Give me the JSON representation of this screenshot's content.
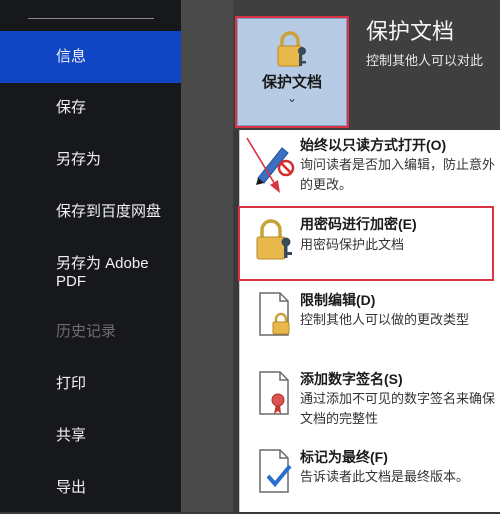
{
  "sidebar": {
    "items": [
      {
        "label": "信息",
        "state": "active"
      },
      {
        "label": "保存",
        "state": "normal"
      },
      {
        "label": "另存为",
        "state": "normal"
      },
      {
        "label": "保存到百度网盘",
        "state": "normal"
      },
      {
        "label": "另存为 Adobe PDF",
        "state": "normal"
      },
      {
        "label": "历史记录",
        "state": "disabled"
      },
      {
        "label": "打印",
        "state": "normal"
      },
      {
        "label": "共享",
        "state": "normal"
      },
      {
        "label": "导出",
        "state": "normal"
      }
    ]
  },
  "protect": {
    "button_label": "保护文档",
    "chevron": "⌄",
    "title": "保护文档",
    "description": "控制其他人可以对此"
  },
  "menu": {
    "items": [
      {
        "title": "始终以只读方式打开(O)",
        "desc": "询问读者是否加入编辑，防止意外的更改。",
        "icon": "pencil-no-icon"
      },
      {
        "title": "用密码进行加密(E)",
        "desc": "用密码保护此文档",
        "icon": "lock-key-icon"
      },
      {
        "title": "限制编辑(D)",
        "desc": "控制其他人可以做的更改类型",
        "icon": "document-lock-icon"
      },
      {
        "title": "添加数字签名(S)",
        "desc": "通过添加不可见的数字签名来确保文档的完整性",
        "icon": "document-ribbon-icon"
      },
      {
        "title": "标记为最终(F)",
        "desc": "告诉读者此文档是最终版本。",
        "icon": "document-check-icon"
      }
    ]
  },
  "colors": {
    "sidebar_bg": "#16181c",
    "active_item": "#1046c4",
    "highlight_box": "#d9343f",
    "button_bg": "#b7cbe5"
  }
}
